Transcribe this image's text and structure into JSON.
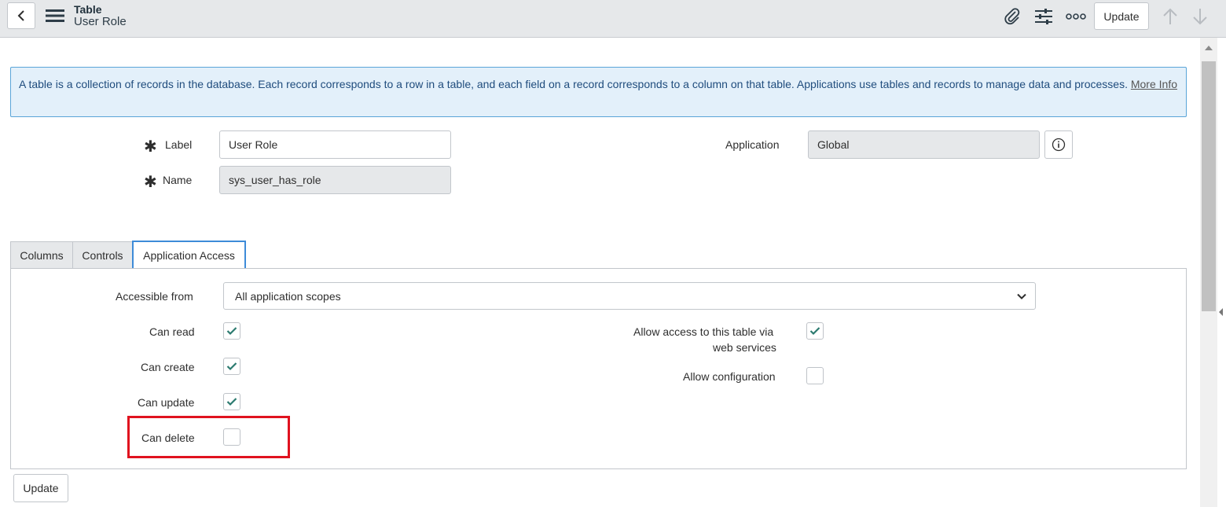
{
  "header": {
    "title": "Table",
    "subtitle": "User Role",
    "update_label": "Update",
    "icons": [
      "back-icon",
      "hamburger-icon",
      "paperclip-icon",
      "sliders-icon",
      "more-icon",
      "arrow-up-icon",
      "arrow-down-icon"
    ]
  },
  "info": {
    "text": "A table is a collection of records in the database. Each record corresponds to a row in a table, and each field on a record corresponds to a column on that table. Applications use tables and records to manage data and processes.",
    "link": "More Info"
  },
  "form": {
    "label_label": "Label",
    "label_value": "User Role",
    "name_label": "Name",
    "name_value": "sys_user_has_role",
    "application_label": "Application",
    "application_value": "Global"
  },
  "tabs": [
    {
      "label": "Columns",
      "active": false
    },
    {
      "label": "Controls",
      "active": false
    },
    {
      "label": "Application Access",
      "active": true
    }
  ],
  "access": {
    "accessible_from_label": "Accessible from",
    "accessible_from_value": "All application scopes",
    "can_read_label": "Can read",
    "can_read": true,
    "can_create_label": "Can create",
    "can_create": true,
    "can_update_label": "Can update",
    "can_update": true,
    "can_delete_label": "Can delete",
    "can_delete": false,
    "web_services_label_1": "Allow access to this table via",
    "web_services_label_2": "web services",
    "web_services": true,
    "allow_config_label": "Allow configuration",
    "allow_config": false
  },
  "footer": {
    "update_label": "Update"
  },
  "colors": {
    "check": "#2b7a6f",
    "highlight": "#e0121f",
    "info_bg": "#e3f0fa",
    "tab_active_border": "#3d8bd8"
  }
}
